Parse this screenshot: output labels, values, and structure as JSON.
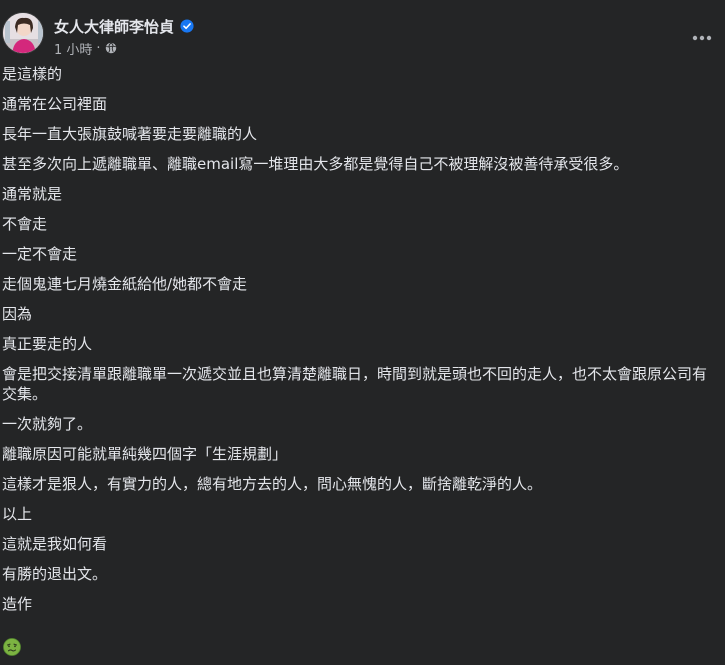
{
  "author": {
    "name": "女人大律師李怡貞",
    "verified": true
  },
  "meta": {
    "time": "1 小時",
    "separator": "·",
    "audience_icon": "globe-icon"
  },
  "more_icon": "more-horizontal-icon",
  "post": {
    "lines": [
      "是這樣的",
      "通常在公司裡面",
      "長年一直大張旗鼓喊著要走要離職的人",
      "甚至多次向上遞離職單、離職email寫一堆理由大多都是覺得自己不被理解沒被善待承受很多。",
      "通常就是",
      "不會走",
      "一定不會走",
      "走個鬼連七月燒金紙給他/她都不會走",
      "因為",
      "真正要走的人",
      "會是把交接清單跟離職單一次遞交並且也算清楚離職日，時間到就是頭也不回的走人，也不太會跟原公司有交集。",
      "一次就夠了。",
      "離職原因可能就單純幾四個字「生涯規劃」",
      "這樣才是狠人，有實力的人，總有地方去的人，問心無愧的人，斷捨離乾淨的人。",
      "以上",
      "這就是我如何看",
      "有勝的退出文。",
      "造作"
    ],
    "emoji": "nauseated-face-emoji"
  },
  "colors": {
    "background": "#242526",
    "text_primary": "#e4e6eb",
    "text_secondary": "#b0b3b8",
    "verified_badge": "#1877f2"
  }
}
